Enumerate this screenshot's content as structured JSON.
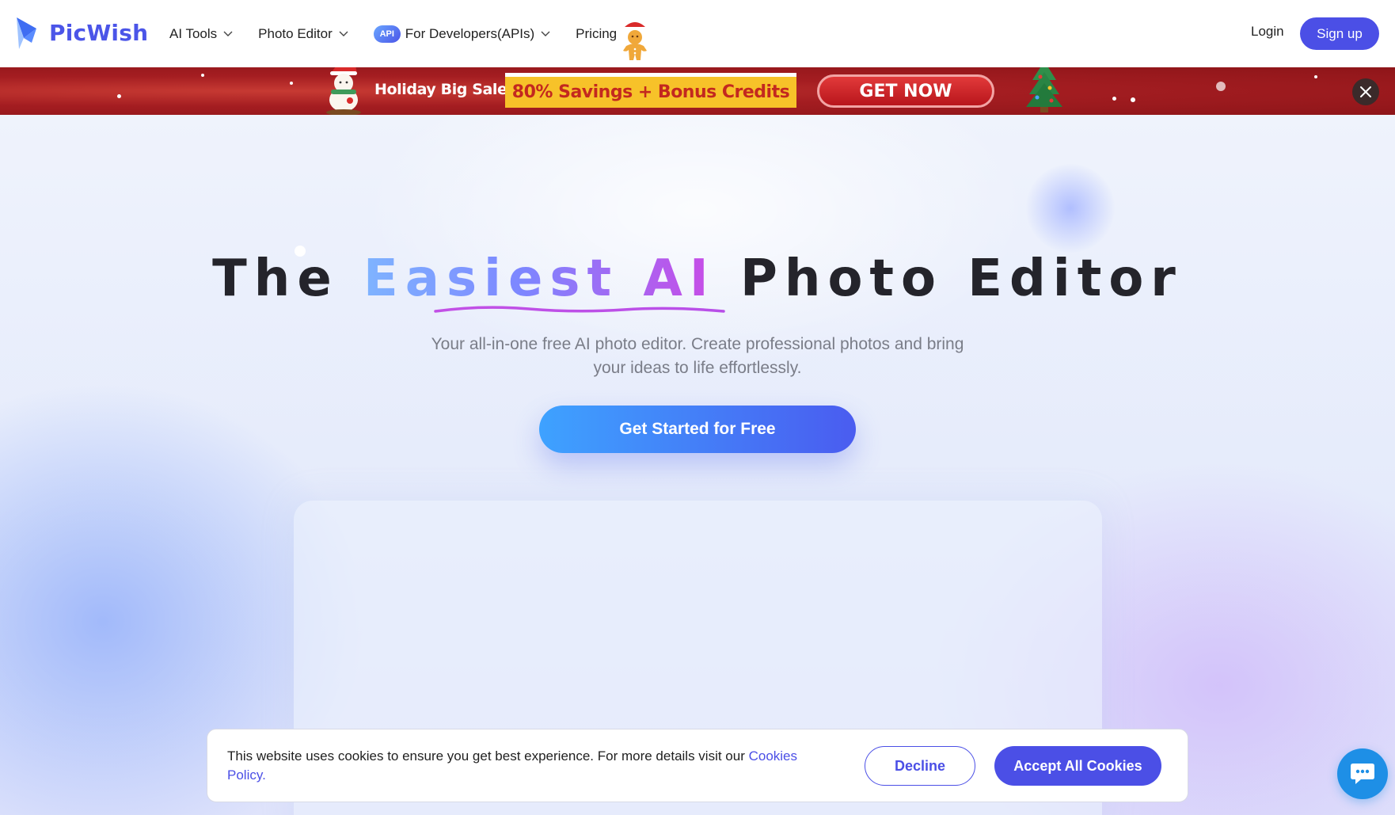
{
  "brand": {
    "name": "PicWish",
    "color": "#4b55e8"
  },
  "nav": {
    "items": [
      {
        "label": "AI Tools",
        "has_dropdown": true
      },
      {
        "label": "Photo Editor",
        "has_dropdown": true
      },
      {
        "label": "For Developers(APIs)",
        "has_dropdown": true,
        "badge": "API"
      },
      {
        "label": "Pricing",
        "has_dropdown": false
      }
    ],
    "login": "Login",
    "signup": "Sign up"
  },
  "banner": {
    "title": "Holiday Big Sale",
    "offer": "80% Savings + Bonus Credits",
    "cta": "GET NOW",
    "close_icon": "close-icon"
  },
  "hero": {
    "headline_before": "The ",
    "headline_highlight": "Easiest AI",
    "headline_after": " Photo Editor",
    "subtitle": "Your all-in-one free AI photo editor. Create professional photos and bring your ideas to life effortlessly.",
    "cta": "Get Started for Free"
  },
  "cookie": {
    "text": "This website uses cookies to ensure you get best experience. For more details visit our ",
    "link": "Cookies Policy.",
    "decline": "Decline",
    "accept": "Accept All Cookies"
  },
  "chat": {
    "icon": "chat-icon"
  },
  "colors": {
    "primary": "#4b4fe6",
    "banner_red": "#a41d21",
    "banner_yellow": "#f7c229",
    "chat_blue": "#1e8fe6"
  }
}
